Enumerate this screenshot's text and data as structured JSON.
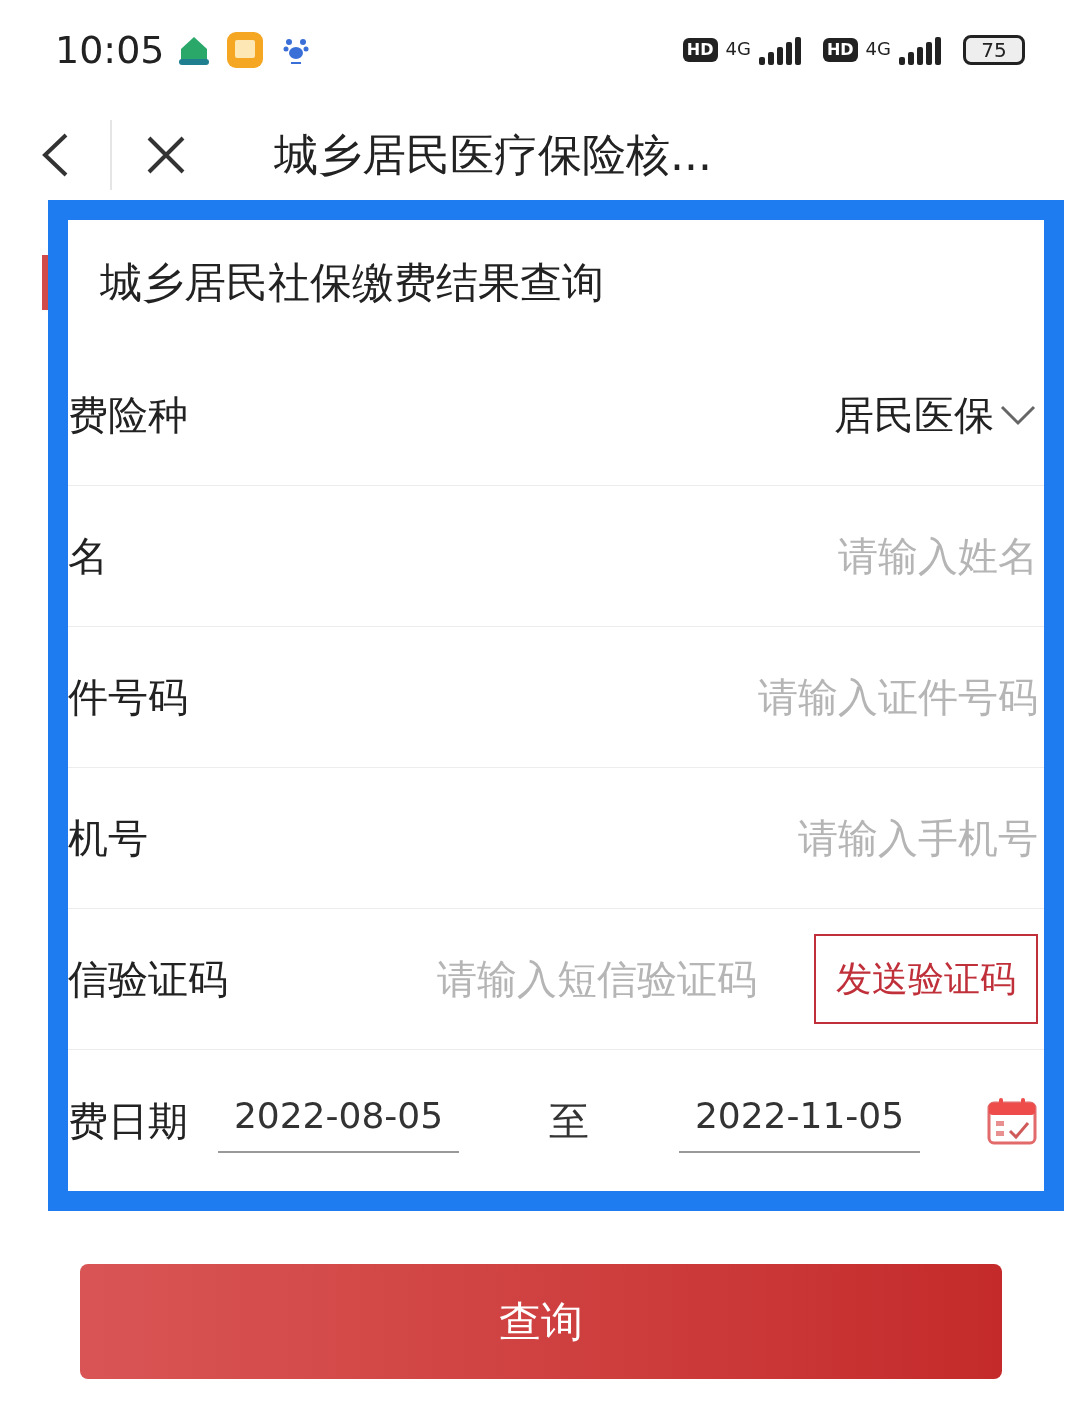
{
  "status_bar": {
    "time": "10:05",
    "battery": "75",
    "network_1": "4G",
    "network_2": "4G",
    "hd_1": "HD",
    "hd_2": "HD"
  },
  "nav": {
    "title": "城乡居民医疗保险核..."
  },
  "form": {
    "title": "城乡居民社保缴费结果查询",
    "rows": [
      {
        "kind": "select",
        "label": "费险种",
        "value": "居民医保"
      },
      {
        "kind": "input",
        "label": "名",
        "placeholder": "请输入姓名"
      },
      {
        "kind": "input",
        "label": "件号码",
        "placeholder": "请输入证件号码"
      },
      {
        "kind": "input",
        "label": "机号",
        "placeholder": "请输入手机号"
      },
      {
        "kind": "code",
        "label": "信验证码",
        "placeholder": "请输入短信验证码",
        "button": "发送验证码"
      },
      {
        "kind": "daterange",
        "label": "费日期",
        "start": "2022-08-05",
        "separator": "至",
        "end": "2022-11-05"
      }
    ]
  },
  "submit": "查询"
}
